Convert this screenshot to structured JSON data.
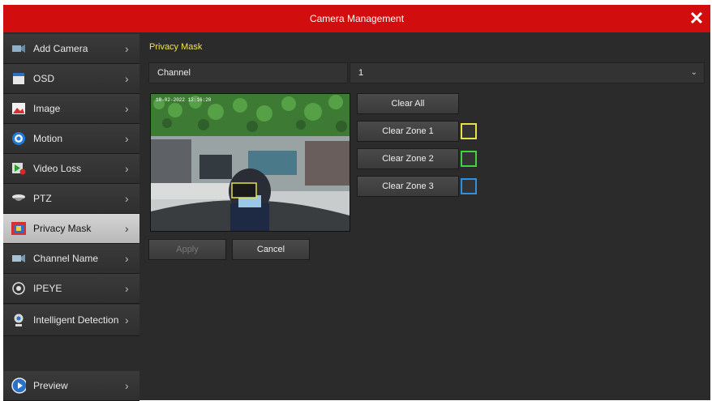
{
  "window": {
    "title": "Camera Management",
    "close_glyph": "✕"
  },
  "sidebar": {
    "items": [
      {
        "label": "Add Camera",
        "icon": "camera-add-icon",
        "active": false
      },
      {
        "label": "OSD",
        "icon": "osd-icon",
        "active": false
      },
      {
        "label": "Image",
        "icon": "image-icon",
        "active": false
      },
      {
        "label": "Motion",
        "icon": "motion-icon",
        "active": false
      },
      {
        "label": "Video Loss",
        "icon": "video-loss-icon",
        "active": false
      },
      {
        "label": "PTZ",
        "icon": "ptz-icon",
        "active": false
      },
      {
        "label": "Privacy Mask",
        "icon": "privacy-mask-icon",
        "active": true
      },
      {
        "label": "Channel Name",
        "icon": "channel-name-icon",
        "active": false
      },
      {
        "label": "IPEYE",
        "icon": "ipeye-icon",
        "active": false
      },
      {
        "label": "Intelligent Detection",
        "icon": "intelligent-detection-icon",
        "active": false
      }
    ],
    "preview_label": "Preview",
    "chevron": "›"
  },
  "main": {
    "section_title": "Privacy Mask",
    "channel_label": "Channel",
    "channel_value": "1",
    "buttons": {
      "clear_all": "Clear All",
      "clear_zone_1": "Clear Zone 1",
      "clear_zone_2": "Clear Zone 2",
      "clear_zone_3": "Clear Zone 3",
      "apply": "Apply",
      "cancel": "Cancel"
    },
    "zone_colors": {
      "zone1": "#e6e24a",
      "zone2": "#3fd43f",
      "zone3": "#2f8fe0"
    },
    "preview_timestamp": "18-02-2022 12:16:20"
  },
  "colors": {
    "title_bar": "#d10d0d",
    "section_title": "#f2e34a",
    "panel": "#2b2b2b"
  }
}
